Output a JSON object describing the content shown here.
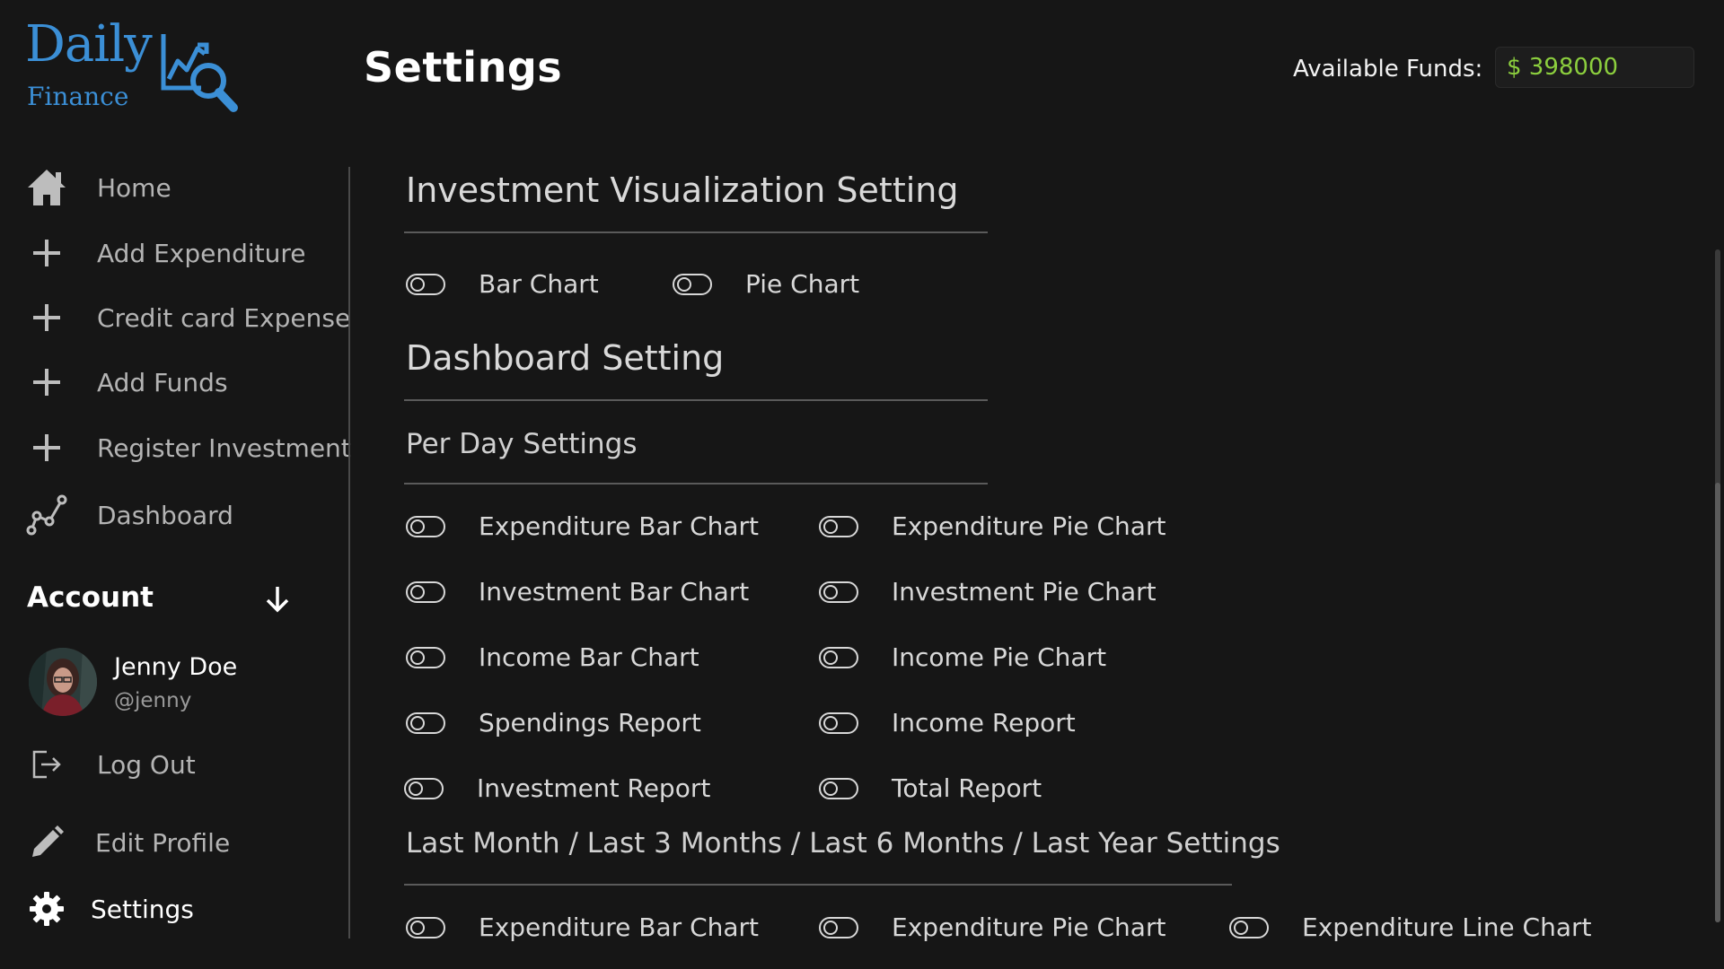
{
  "logo": {
    "word": "Daily",
    "sub": "Finance"
  },
  "header": {
    "title": "Settings",
    "funds_label": "Available Funds:",
    "funds_value": "$ 398000"
  },
  "sidebar": {
    "items": [
      {
        "label": "Home",
        "icon": "home-icon"
      },
      {
        "label": "Add Expenditure",
        "icon": "plus-icon"
      },
      {
        "label": "Credit card Expense",
        "icon": "plus-icon"
      },
      {
        "label": "Add Funds",
        "icon": "plus-icon"
      },
      {
        "label": "Register Investment",
        "icon": "plus-icon"
      },
      {
        "label": "Dashboard",
        "icon": "chart-line-icon"
      }
    ],
    "account": {
      "heading": "Account",
      "user_name": "Jenny Doe",
      "user_handle": "@jenny",
      "logout": "Log Out",
      "edit_profile": "Edit Profile",
      "settings": "Settings"
    }
  },
  "main": {
    "investment_section": {
      "title": "Investment Visualization Setting",
      "toggles": [
        "Bar Chart",
        "Pie Chart"
      ]
    },
    "dashboard_section": {
      "title": "Dashboard Setting",
      "per_day": {
        "title": "Per Day Settings",
        "left": [
          "Expenditure Bar Chart",
          "Investment Bar Chart",
          "Income Bar Chart",
          "Spendings Report",
          "Investment Report"
        ],
        "right": [
          "Expenditure Pie Chart",
          "Investment Pie Chart",
          "Income Pie Chart",
          "Income Report",
          "Total Report"
        ]
      },
      "period": {
        "title": "Last Month / Last 3 Months / Last 6 Months / Last Year Settings",
        "toggles": [
          "Expenditure Bar Chart",
          "Expenditure Pie Chart",
          "Expenditure Line Chart"
        ]
      }
    }
  },
  "colors": {
    "background": "#161616",
    "brand_blue": "#3b8fd6",
    "funds_green": "#8ccf3e"
  }
}
